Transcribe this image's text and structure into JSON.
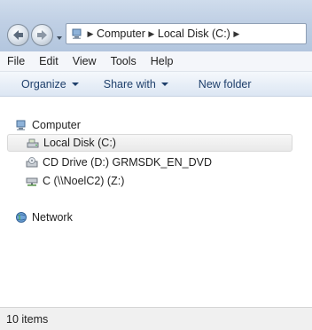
{
  "address_bar": {
    "crumbs": [
      "Computer",
      "Local Disk (C:)"
    ]
  },
  "menu": {
    "items": [
      "File",
      "Edit",
      "View",
      "Tools",
      "Help"
    ]
  },
  "command_bar": {
    "organize": "Organize",
    "share_with": "Share with",
    "new_folder": "New folder"
  },
  "nav_pane": {
    "computer": "Computer",
    "drives": [
      "Local Disk (C:)",
      "CD Drive (D:) GRMSDK_EN_DVD",
      "C (\\\\NoelC2) (Z:)"
    ],
    "network": "Network",
    "selected": "Local Disk (C:)"
  },
  "status": {
    "items": "10 items"
  },
  "colors": {
    "command_text": "#1e3f6b",
    "selection_bg": "#e9e9e9",
    "frame": "#bfcfe4"
  }
}
